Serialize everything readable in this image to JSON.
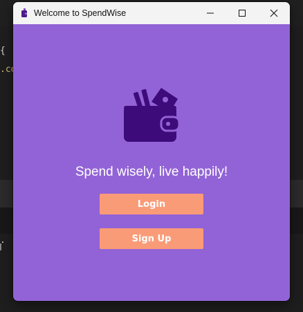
{
  "window": {
    "title": "Welcome to SpendWise",
    "app_icon": "wallet-app-icon",
    "controls": [
      "minimize-icon",
      "maximize-icon",
      "close-icon"
    ]
  },
  "background_editor": {
    "line1": "{",
    "line2": ".co",
    "line3": "."
  },
  "main": {
    "logo_icon": "wallet-icon",
    "tagline": "Spend wisely, live happily!",
    "login_label": "Login",
    "signup_label": "Sign Up"
  },
  "colors": {
    "window_background": "#9263d6",
    "button_background": "#fa9b78",
    "wallet_icon": "#3e0b7a",
    "titlebar": "#f3f3f3"
  }
}
